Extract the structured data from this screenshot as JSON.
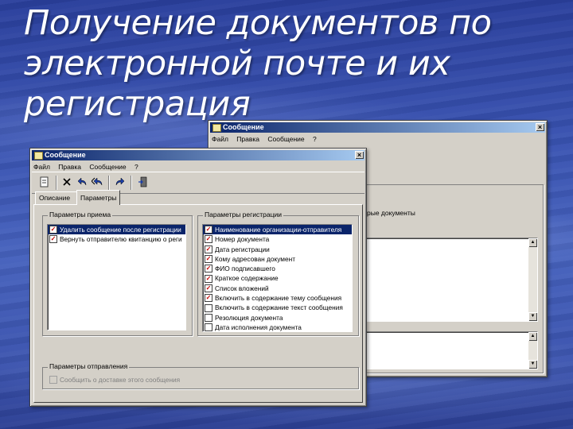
{
  "slide": {
    "title_lines": [
      "Получение документов по",
      "электронной почте и их",
      "регистрация"
    ]
  },
  "back_window": {
    "title": "Сообщение",
    "menu": [
      "Файл",
      "Правка",
      "Сообщение",
      "?"
    ],
    "close_glyph": "×",
    "partial_label": "рые документы"
  },
  "front_window": {
    "title": "Сообщение",
    "close_glyph": "×",
    "menu": [
      "Файл",
      "Правка",
      "Сообщение",
      "?"
    ],
    "tabs": [
      "Описание",
      "Параметры"
    ],
    "active_tab": "Параметры",
    "reception_group": {
      "label": "Параметры приема",
      "items": [
        {
          "text": "Удалить сообщение после регистрации",
          "checked": true,
          "selected": true
        },
        {
          "text": "Вернуть отправителю квитанцию о реги",
          "checked": true,
          "selected": false
        }
      ]
    },
    "registration_group": {
      "label": "Параметры регистрации",
      "items": [
        {
          "text": "Наименование организации-отправителя",
          "checked": true,
          "selected": true
        },
        {
          "text": "Номер документа",
          "checked": true,
          "selected": false
        },
        {
          "text": "Дата регистрации",
          "checked": true,
          "selected": false
        },
        {
          "text": "Кому адресован документ",
          "checked": true,
          "selected": false
        },
        {
          "text": "ФИО подписавшего",
          "checked": true,
          "selected": false
        },
        {
          "text": "Краткое содержание",
          "checked": true,
          "selected": false
        },
        {
          "text": "Список вложений",
          "checked": true,
          "selected": false
        },
        {
          "text": "Включить в содержание тему сообщения",
          "checked": true,
          "selected": false
        },
        {
          "text": "Включить в содержание текст сообщения",
          "checked": false,
          "selected": false
        },
        {
          "text": "Резолюция документа",
          "checked": false,
          "selected": false
        },
        {
          "text": "Дата исполнения документа",
          "checked": false,
          "selected": false
        }
      ]
    },
    "reply_group": {
      "label": "Параметры отправления",
      "items": [
        {
          "text": "Сообщить о доставке этого сообщения",
          "checked": false,
          "disabled": true
        }
      ]
    }
  },
  "colors": {
    "title_bar": "#0a246a",
    "window_face": "#d4d0c8",
    "selection": "#0a246a",
    "check_mark": "#c00000"
  }
}
